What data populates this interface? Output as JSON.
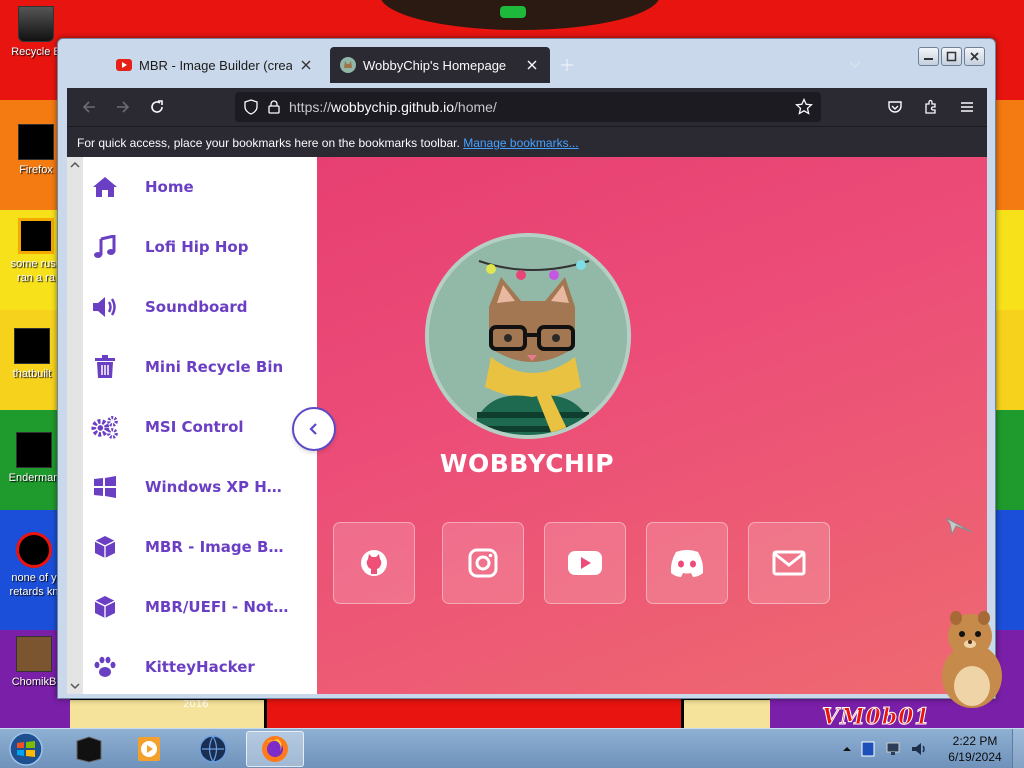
{
  "desktop": {
    "icons": [
      {
        "label": "Recycle B"
      },
      {
        "label": "Firefox"
      },
      {
        "label": "some russ"
      },
      {
        "label": "ran a ra"
      },
      {
        "label": "thatbuilt"
      },
      {
        "label": "Enderman"
      },
      {
        "label": "none of y"
      },
      {
        "label": "retards kn"
      },
      {
        "label": "ChomikB"
      }
    ],
    "wallpaper_text": "VM0b01",
    "wallpaper_year": "2016"
  },
  "browser": {
    "tabs": [
      {
        "title": "MBR - Image Builder (create yo",
        "favicon": "youtube-icon"
      },
      {
        "title": "WobbyChip's Homepage",
        "favicon": "cat-favicon"
      }
    ],
    "url_prefix": "https://",
    "url_host": "wobbychip.github.io",
    "url_path": "/home/",
    "bookmarks_text": "For quick access, place your bookmarks here on the bookmarks toolbar.",
    "bookmarks_link": "Manage bookmarks..."
  },
  "page": {
    "sidebar": [
      {
        "label": "Home",
        "icon": "home-icon"
      },
      {
        "label": "Lofi Hip Hop",
        "icon": "music-icon"
      },
      {
        "label": "Soundboard",
        "icon": "speaker-icon"
      },
      {
        "label": "Mini Recycle Bin",
        "icon": "trash-icon"
      },
      {
        "label": "MSI Control",
        "icon": "gears-icon"
      },
      {
        "label": "Windows XP Hor...",
        "icon": "windows-icon"
      },
      {
        "label": "MBR - Image Bu...",
        "icon": "cube-icon"
      },
      {
        "label": "MBR/UEFI - Not...",
        "icon": "cube-icon"
      },
      {
        "label": "KitteyHacker",
        "icon": "paw-icon"
      }
    ],
    "site_name": "WOBBYCHIP",
    "socials": [
      "github-icon",
      "instagram-icon",
      "youtube-icon",
      "discord-icon",
      "mail-icon"
    ]
  },
  "taskbar": {
    "time": "2:22 PM",
    "date": "6/19/2024"
  },
  "colors": {
    "accent": "#6a3fc4",
    "page_bg": "#e8457a",
    "browser_chrome": "#2b2a33"
  }
}
